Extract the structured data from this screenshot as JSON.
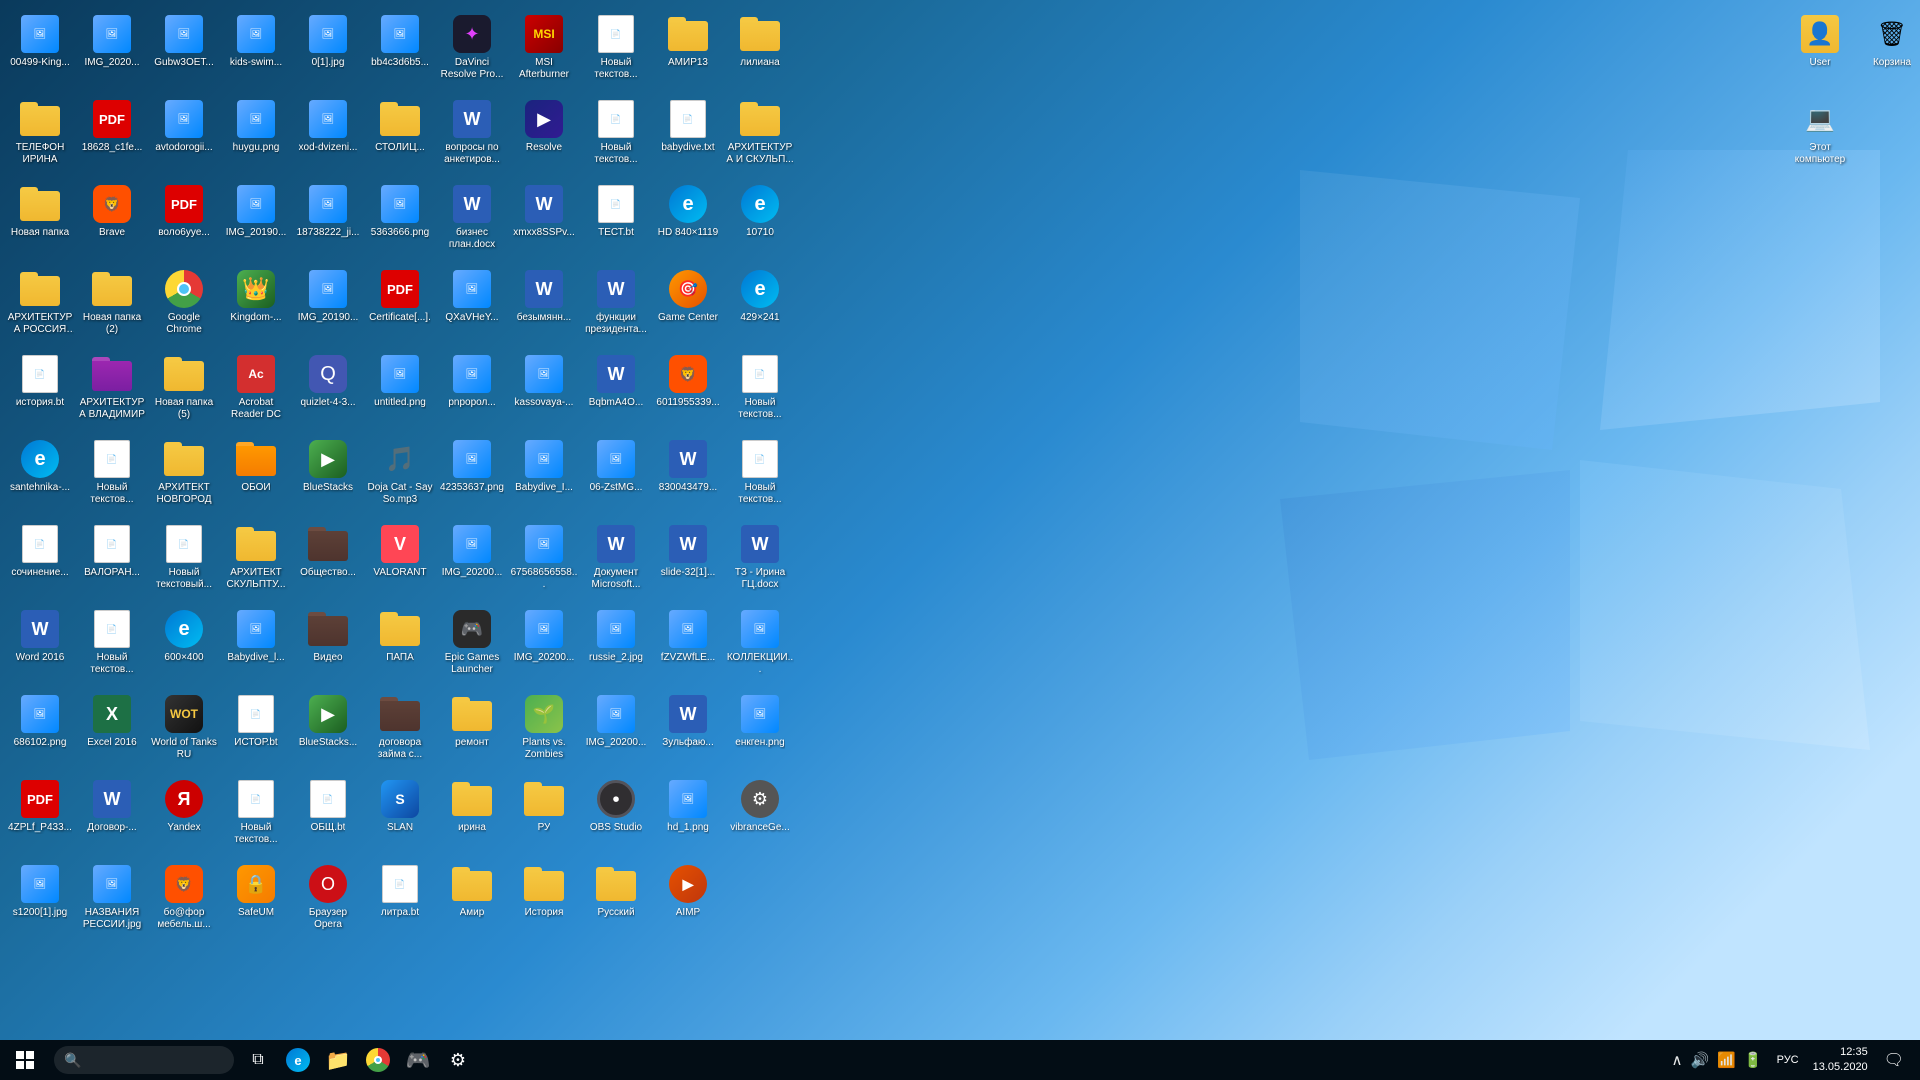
{
  "desktop": {
    "icons": [
      {
        "id": "i1",
        "label": "00499-King...",
        "type": "img",
        "row": 1,
        "col": 1
      },
      {
        "id": "i2",
        "label": "IMG_2020...",
        "type": "img",
        "row": 1,
        "col": 2
      },
      {
        "id": "i3",
        "label": "Gubw3OET...",
        "type": "img",
        "row": 1,
        "col": 3
      },
      {
        "id": "i4",
        "label": "kids-swim...",
        "type": "img",
        "row": 1,
        "col": 4
      },
      {
        "id": "i5",
        "label": "0[1].jpg",
        "type": "img",
        "row": 1,
        "col": 5
      },
      {
        "id": "i6",
        "label": "bb4c3d6b5...",
        "type": "img",
        "row": 1,
        "col": 6
      },
      {
        "id": "i7",
        "label": "DaVinci Resolve Pro...",
        "type": "davinci",
        "row": 1,
        "col": 7
      },
      {
        "id": "i8",
        "label": "MSI Afterburner",
        "type": "msi",
        "row": 1,
        "col": 8
      },
      {
        "id": "i9",
        "label": "Новый текстов...",
        "type": "txt",
        "row": 1,
        "col": 9
      },
      {
        "id": "i10",
        "label": "АМИР13",
        "type": "folder",
        "row": 1,
        "col": 10
      },
      {
        "id": "i11",
        "label": "лилиана",
        "type": "folder",
        "row": 1,
        "col": 11
      },
      {
        "id": "i12",
        "label": "ТЕЛЕФОН ИРИНА",
        "type": "folder",
        "row": 1,
        "col": 12
      },
      {
        "id": "i13",
        "label": "18628_c1fe...",
        "type": "pdf",
        "row": 2,
        "col": 1
      },
      {
        "id": "i14",
        "label": "avtodorogii...",
        "type": "img",
        "row": 2,
        "col": 2
      },
      {
        "id": "i15",
        "label": "huygu.png",
        "type": "img",
        "row": 2,
        "col": 3
      },
      {
        "id": "i16",
        "label": "xod-dvizeni...",
        "type": "img",
        "row": 2,
        "col": 4
      },
      {
        "id": "i17",
        "label": "СТОЛИЦ...",
        "type": "folder",
        "row": 2,
        "col": 5
      },
      {
        "id": "i18",
        "label": "вопросы по анкетиров...",
        "type": "word",
        "row": 2,
        "col": 6
      },
      {
        "id": "i19",
        "label": "Resolve",
        "type": "resolve",
        "row": 2,
        "col": 7
      },
      {
        "id": "i20",
        "label": "Новый текстов...",
        "type": "txt",
        "row": 2,
        "col": 8
      },
      {
        "id": "i21",
        "label": "babydive.txt",
        "type": "txt",
        "row": 2,
        "col": 9
      },
      {
        "id": "i22",
        "label": "АРХИТЕКТУРА И СКУЛЬП...",
        "type": "folder",
        "row": 2,
        "col": 10
      },
      {
        "id": "i23",
        "label": "Новая папка",
        "type": "folder",
        "row": 2,
        "col": 11
      },
      {
        "id": "i24",
        "label": "Brave",
        "type": "brave",
        "row": 2,
        "col": 12
      },
      {
        "id": "i25",
        "label": "воло6уye...",
        "type": "pdf",
        "row": 3,
        "col": 1
      },
      {
        "id": "i26",
        "label": "IMG_20190...",
        "type": "img",
        "row": 3,
        "col": 2
      },
      {
        "id": "i27",
        "label": "18738222_ji...",
        "type": "img",
        "row": 3,
        "col": 3
      },
      {
        "id": "i28",
        "label": "5363666.png",
        "type": "img",
        "row": 3,
        "col": 4
      },
      {
        "id": "i29",
        "label": "бизнес план.docx",
        "type": "word",
        "row": 3,
        "col": 5
      },
      {
        "id": "i30",
        "label": "xmxx8SSPv...",
        "type": "word",
        "row": 3,
        "col": 6
      },
      {
        "id": "i31",
        "label": "ТЕСТ.bt",
        "type": "txt",
        "row": 3,
        "col": 7
      },
      {
        "id": "i32",
        "label": "HD 840×1119",
        "type": "edge",
        "row": 3,
        "col": 8
      },
      {
        "id": "i33",
        "label": "10710",
        "type": "edge",
        "row": 3,
        "col": 9
      },
      {
        "id": "i34",
        "label": "АРХИТЕКТУРА РОССИЯ И...",
        "type": "folder",
        "row": 3,
        "col": 10
      },
      {
        "id": "i35",
        "label": "Новая папка (2)",
        "type": "folder",
        "row": 3,
        "col": 11
      },
      {
        "id": "i36",
        "label": "Google Chrome",
        "type": "chrome",
        "row": 3,
        "col": 12
      },
      {
        "id": "i37",
        "label": "Kingdom-...",
        "type": "kingdom",
        "row": 4,
        "col": 1
      },
      {
        "id": "i38",
        "label": "IMG_20190...",
        "type": "img",
        "row": 4,
        "col": 2
      },
      {
        "id": "i39",
        "label": "Certificate[...].",
        "type": "pdf",
        "row": 4,
        "col": 3
      },
      {
        "id": "i40",
        "label": "QXaVHeY...",
        "type": "img",
        "row": 4,
        "col": 4
      },
      {
        "id": "i41",
        "label": "безымянн...",
        "type": "word",
        "row": 4,
        "col": 5
      },
      {
        "id": "i42",
        "label": "функции президента...",
        "type": "word",
        "row": 4,
        "col": 6
      },
      {
        "id": "i43",
        "label": "Game Center",
        "type": "gamecenter",
        "row": 4,
        "col": 7
      },
      {
        "id": "i44",
        "label": "429×241",
        "type": "edge",
        "row": 4,
        "col": 8
      },
      {
        "id": "i45",
        "label": "история.bt",
        "type": "txt",
        "row": 4,
        "col": 9
      },
      {
        "id": "i46",
        "label": "АРХИТЕКТУРА ВЛАДИМИР",
        "type": "purple-folder",
        "row": 4,
        "col": 10
      },
      {
        "id": "i47",
        "label": "Новая папка (5)",
        "type": "folder",
        "row": 4,
        "col": 11
      },
      {
        "id": "i48",
        "label": "Acrobat Reader DC",
        "type": "acrobat",
        "row": 4,
        "col": 12
      },
      {
        "id": "i49",
        "label": "quizlet-4-3...",
        "type": "quizlet",
        "row": 5,
        "col": 1
      },
      {
        "id": "i50",
        "label": "untitled.png",
        "type": "img",
        "row": 5,
        "col": 2
      },
      {
        "id": "i51",
        "label": "pnророл...",
        "type": "img",
        "row": 5,
        "col": 3
      },
      {
        "id": "i52",
        "label": "kassovaya-...",
        "type": "img",
        "row": 5,
        "col": 4
      },
      {
        "id": "i53",
        "label": "BqbmA4O...",
        "type": "word",
        "row": 5,
        "col": 5
      },
      {
        "id": "i54",
        "label": "6011955339...",
        "type": "brave",
        "row": 5,
        "col": 6
      },
      {
        "id": "i55",
        "label": "Новый текстов...",
        "type": "txt",
        "row": 5,
        "col": 7
      },
      {
        "id": "i56",
        "label": "santehnika-...",
        "type": "edge",
        "row": 5,
        "col": 8
      },
      {
        "id": "i57",
        "label": "Новый текстов...",
        "type": "txt",
        "row": 5,
        "col": 9
      },
      {
        "id": "i58",
        "label": "АРХИТЕКТ НОВГОРОД",
        "type": "folder",
        "row": 5,
        "col": 10
      },
      {
        "id": "i59",
        "label": "ОБОИ",
        "type": "orange-folder",
        "row": 5,
        "col": 11
      },
      {
        "id": "i60",
        "label": "BlueStacks",
        "type": "bluestacks",
        "row": 5,
        "col": 12
      },
      {
        "id": "i61",
        "label": "Doja Cat - Say So.mp3",
        "type": "sound",
        "row": 6,
        "col": 1
      },
      {
        "id": "i62",
        "label": "42353637.png",
        "type": "img",
        "row": 6,
        "col": 2
      },
      {
        "id": "i63",
        "label": "Babydive_I...",
        "type": "img",
        "row": 6,
        "col": 3
      },
      {
        "id": "i64",
        "label": "06-ZstMG...",
        "type": "img",
        "row": 6,
        "col": 4
      },
      {
        "id": "i65",
        "label": "830043479...",
        "type": "word",
        "row": 6,
        "col": 5
      },
      {
        "id": "i66",
        "label": "Новый текстов...",
        "type": "txt",
        "row": 6,
        "col": 6
      },
      {
        "id": "i67",
        "label": "сочинение...",
        "type": "txt",
        "row": 6,
        "col": 7
      },
      {
        "id": "i68",
        "label": "ВАЛОРАН...",
        "type": "txt",
        "row": 6,
        "col": 8
      },
      {
        "id": "i69",
        "label": "Новый текстовый...",
        "type": "txt",
        "row": 6,
        "col": 9
      },
      {
        "id": "i70",
        "label": "АРХИТЕКТ СКУЛЬПТУ...",
        "type": "folder",
        "row": 6,
        "col": 10
      },
      {
        "id": "i71",
        "label": "Общество...",
        "type": "dark-folder",
        "row": 6,
        "col": 11
      },
      {
        "id": "i72",
        "label": "VALORANT",
        "type": "valorant",
        "row": 6,
        "col": 12
      },
      {
        "id": "i73",
        "label": "IMG_20200...",
        "type": "img",
        "row": 7,
        "col": 1
      },
      {
        "id": "i74",
        "label": "67568656558...",
        "type": "img",
        "row": 7,
        "col": 2
      },
      {
        "id": "i75",
        "label": "Документ Microsoft...",
        "type": "word",
        "row": 7,
        "col": 3
      },
      {
        "id": "i76",
        "label": "slide-32[1]...",
        "type": "word",
        "row": 7,
        "col": 4
      },
      {
        "id": "i77",
        "label": "ТЗ - Ирина ГЦ.docx",
        "type": "word",
        "row": 7,
        "col": 5
      },
      {
        "id": "i78",
        "label": "Word 2016",
        "type": "word",
        "row": 7,
        "col": 6
      },
      {
        "id": "i79",
        "label": "Новый текстов...",
        "type": "txt",
        "row": 7,
        "col": 7
      },
      {
        "id": "i80",
        "label": "600×400",
        "type": "edge",
        "row": 7,
        "col": 8
      },
      {
        "id": "i81",
        "label": "Babydive_l...",
        "type": "img",
        "row": 7,
        "col": 9
      },
      {
        "id": "i82",
        "label": "Видео",
        "type": "dark-folder",
        "row": 7,
        "col": 10
      },
      {
        "id": "i83",
        "label": "ПАПА",
        "type": "folder",
        "row": 7,
        "col": 11
      },
      {
        "id": "i84",
        "label": "Epic Games Launcher",
        "type": "epic",
        "row": 7,
        "col": 12
      },
      {
        "id": "i85",
        "label": "IMG_20200...",
        "type": "img",
        "row": 8,
        "col": 1
      },
      {
        "id": "i86",
        "label": "russie_2.jpg",
        "type": "img",
        "row": 8,
        "col": 2
      },
      {
        "id": "i87",
        "label": "fZVZWfLE...",
        "type": "img",
        "row": 8,
        "col": 3
      },
      {
        "id": "i88",
        "label": "КОЛЛЕКЦИИ...",
        "type": "img",
        "row": 8,
        "col": 4
      },
      {
        "id": "i89",
        "label": "686102.png",
        "type": "img",
        "row": 8,
        "col": 5
      },
      {
        "id": "i90",
        "label": "Excel 2016",
        "type": "excel",
        "row": 8,
        "col": 6
      },
      {
        "id": "i91",
        "label": "World of Tanks RU",
        "type": "wot",
        "row": 8,
        "col": 7
      },
      {
        "id": "i92",
        "label": "ИСТОР.bt",
        "type": "txt",
        "row": 8,
        "col": 8
      },
      {
        "id": "i93",
        "label": "BlueStacks...",
        "type": "bluestacks",
        "row": 8,
        "col": 9
      },
      {
        "id": "i94",
        "label": "договора займа с...",
        "type": "dark-folder",
        "row": 8,
        "col": 10
      },
      {
        "id": "i95",
        "label": "ремонт",
        "type": "folder",
        "row": 8,
        "col": 11
      },
      {
        "id": "i96",
        "label": "Plants vs. Zombies",
        "type": "pvz",
        "row": 8,
        "col": 12
      },
      {
        "id": "i97",
        "label": "IMG_20200...",
        "type": "img",
        "row": 9,
        "col": 1
      },
      {
        "id": "i98",
        "label": "Зульфаю...",
        "type": "word",
        "row": 9,
        "col": 2
      },
      {
        "id": "i99",
        "label": "енкген.png",
        "type": "img",
        "row": 9,
        "col": 3
      },
      {
        "id": "i100",
        "label": "4ZPLf_P433...",
        "type": "pdf",
        "row": 9,
        "col": 4
      },
      {
        "id": "i101",
        "label": "Договор-...",
        "type": "word",
        "row": 9,
        "col": 5
      },
      {
        "id": "i102",
        "label": "Yandex",
        "type": "yandex",
        "row": 9,
        "col": 6
      },
      {
        "id": "i103",
        "label": "Новый текстов...",
        "type": "txt",
        "row": 9,
        "col": 7
      },
      {
        "id": "i104",
        "label": "ОБЩ.bt",
        "type": "txt",
        "row": 9,
        "col": 8
      },
      {
        "id": "i105",
        "label": "SLAN",
        "type": "slan",
        "row": 9,
        "col": 9
      },
      {
        "id": "i106",
        "label": "ирина",
        "type": "folder",
        "row": 9,
        "col": 10
      },
      {
        "id": "i107",
        "label": "РУ",
        "type": "folder",
        "row": 9,
        "col": 11
      },
      {
        "id": "i108",
        "label": "OBS Studio",
        "type": "obs",
        "row": 9,
        "col": 12
      },
      {
        "id": "i109",
        "label": "hd_1.png",
        "type": "img",
        "row": 10,
        "col": 1
      },
      {
        "id": "i110",
        "label": "vibranceGe...",
        "type": "settings",
        "row": 10,
        "col": 2
      },
      {
        "id": "i111",
        "label": "s1200[1].jpg",
        "type": "img",
        "row": 10,
        "col": 3
      },
      {
        "id": "i112",
        "label": "НАЗВАНИЯ РECСИИ.jpg",
        "type": "img",
        "row": 10,
        "col": 4
      },
      {
        "id": "i113",
        "label": "бо@фор мебель.ш...",
        "type": "brave",
        "row": 10,
        "col": 5
      },
      {
        "id": "i114",
        "label": "SafeUM",
        "type": "safe",
        "row": 10,
        "col": 6
      },
      {
        "id": "i115",
        "label": "Браузер Opera",
        "type": "opera",
        "row": 10,
        "col": 7
      },
      {
        "id": "i116",
        "label": "литра.bt",
        "type": "txt",
        "row": 10,
        "col": 8
      },
      {
        "id": "i117",
        "label": "Амир",
        "type": "folder",
        "row": 10,
        "col": 9
      },
      {
        "id": "i118",
        "label": "История",
        "type": "folder",
        "row": 10,
        "col": 10
      },
      {
        "id": "i119",
        "label": "Русский",
        "type": "folder",
        "row": 10,
        "col": 11
      },
      {
        "id": "i120",
        "label": "AIMP",
        "type": "aimp",
        "row": 10,
        "col": 12
      }
    ],
    "right_icons": [
      {
        "id": "r1",
        "label": "User",
        "type": "user-folder"
      },
      {
        "id": "r2",
        "label": "Корзина",
        "type": "recycle"
      },
      {
        "id": "r3",
        "label": "Этот компьютер",
        "type": "computer"
      }
    ]
  },
  "taskbar": {
    "start_label": "Start",
    "search_placeholder": "Search",
    "pinned": [
      {
        "label": "Task View",
        "type": "taskview"
      },
      {
        "label": "Edge",
        "type": "edge"
      },
      {
        "label": "File Explorer",
        "type": "explorer"
      },
      {
        "label": "Chrome",
        "type": "chrome"
      },
      {
        "label": "Steam",
        "type": "steam"
      },
      {
        "label": "Settings",
        "type": "settings"
      }
    ],
    "tray": {
      "lang": "РУС",
      "time": "12:35",
      "date": "13.05.2020"
    }
  }
}
